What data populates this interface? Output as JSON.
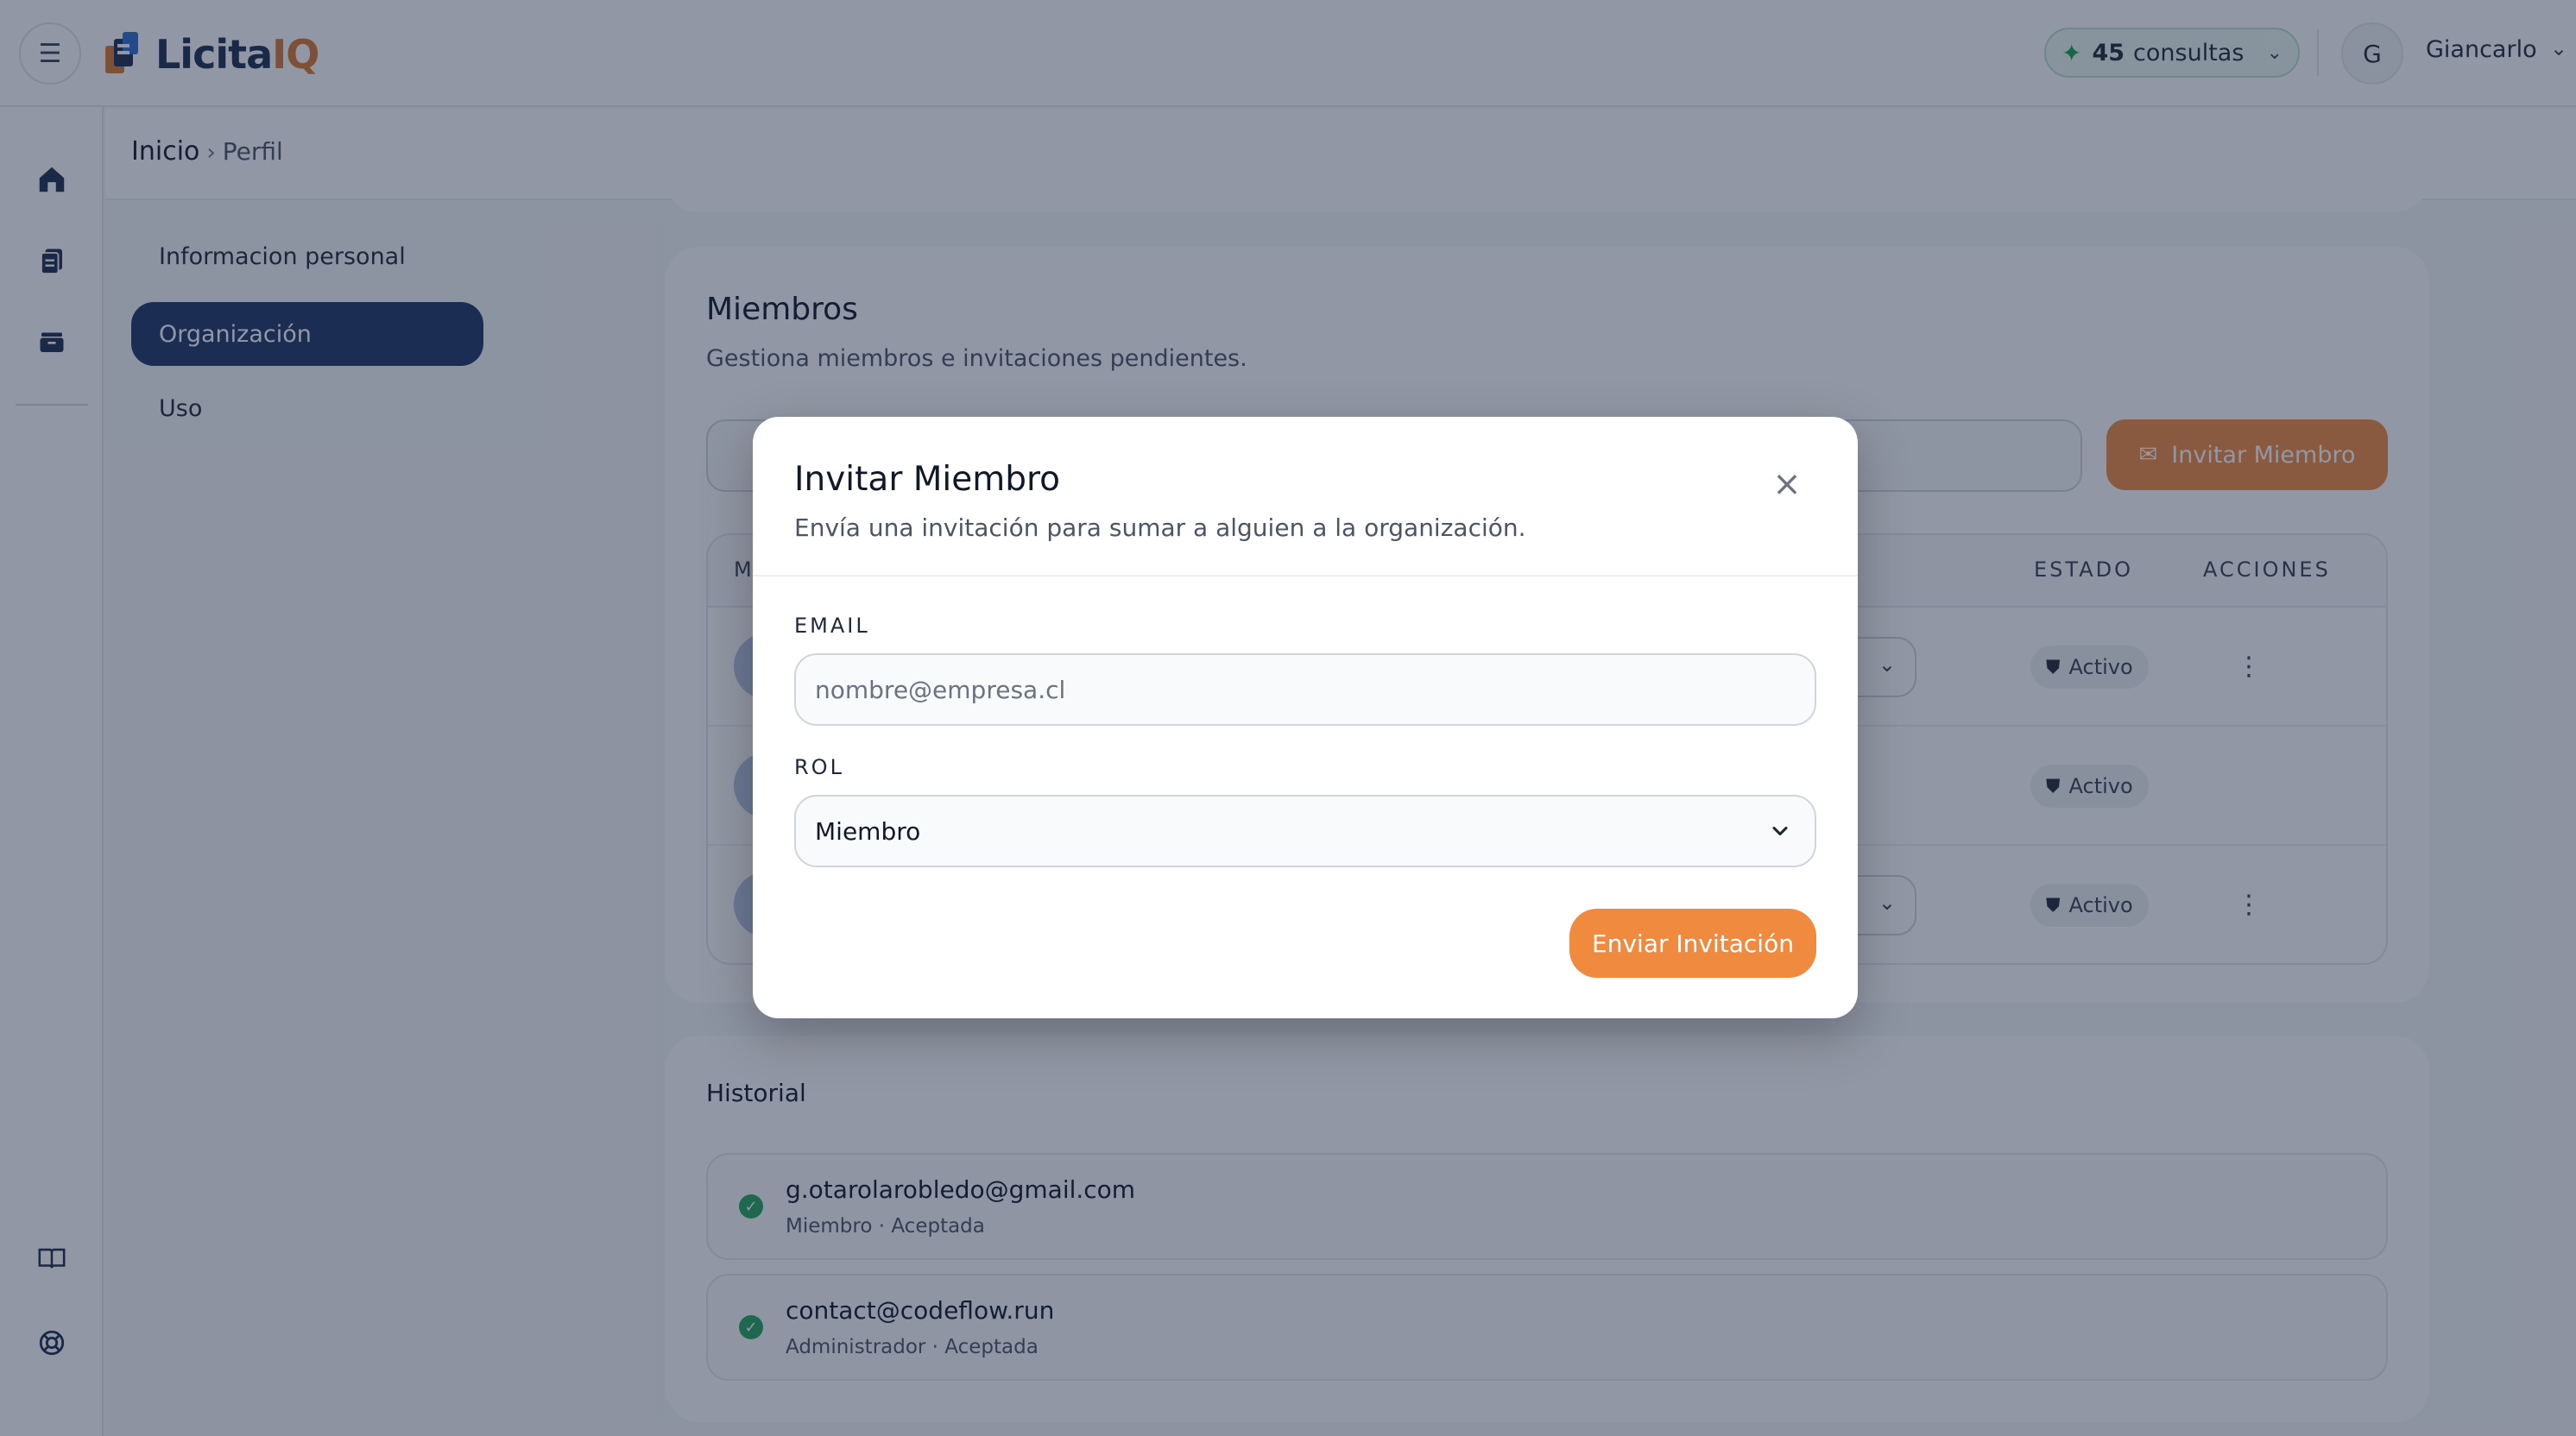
{
  "brand": {
    "name_main": "Licita",
    "name_accent": "IQ",
    "accent_color": "#d9772f",
    "primary_color": "#1f3566"
  },
  "topbar": {
    "credits_count": "45",
    "credits_label": "consultas",
    "avatar_initial": "G",
    "username": "Giancarlo"
  },
  "breadcrumb": {
    "home": "Inicio",
    "current": "Perfil"
  },
  "profile_nav": [
    {
      "label": "Informacion personal"
    },
    {
      "label": "Organización",
      "active": true
    },
    {
      "label": "Uso"
    }
  ],
  "members": {
    "title": "Miembros",
    "subtitle": "Gestiona miembros e invitaciones pendientes.",
    "invite_button": "Invitar Miembro",
    "columns": {
      "estado": "ESTADO",
      "acciones": "ACCIONES",
      "first_letter": "M"
    },
    "rows": [
      {
        "status": "Activo"
      },
      {
        "status": "Activo"
      },
      {
        "status": "Activo"
      }
    ]
  },
  "history": {
    "title": "Historial",
    "items": [
      {
        "email": "g.otarolarobledo@gmail.com",
        "meta": "Miembro · Aceptada"
      },
      {
        "email": "contact@codeflow.run",
        "meta": "Administrador · Aceptada"
      }
    ]
  },
  "modal": {
    "title": "Invitar Miembro",
    "subtitle": "Envía una invitación para sumar a alguien a la organización.",
    "email_label": "EMAIL",
    "email_placeholder": "nombre@empresa.cl",
    "email_value": "",
    "role_label": "ROL",
    "role_value": "Miembro",
    "submit_label": "Enviar Invitación",
    "accent_color": "#f08a3e"
  }
}
